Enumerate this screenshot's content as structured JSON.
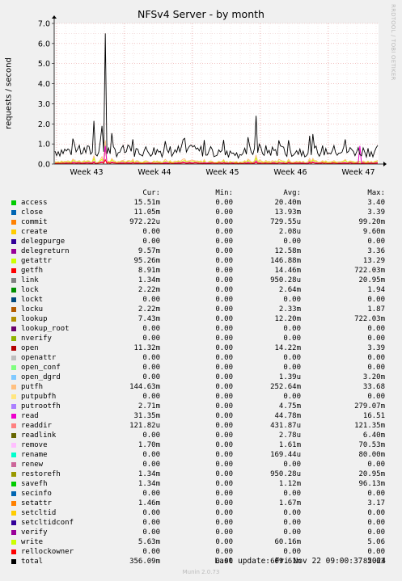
{
  "chart_data": {
    "type": "line",
    "title": "NFSv4 Server - by month",
    "ylabel": "requests / second",
    "watermark": "RRDTOOL / TOBI OETIKER",
    "ylim": [
      0,
      7
    ],
    "yticks": [
      "0.0",
      "1.0",
      "2.0",
      "3.0",
      "4.0",
      "5.0",
      "6.0",
      "7.0"
    ],
    "xticks": [
      "Week 43",
      "Week 44",
      "Week 45",
      "Week 46",
      "Week 47"
    ],
    "total_series_peaks": [
      {
        "label": "Week 43",
        "value": 6.5
      },
      {
        "label": "Week 46",
        "value": 2.4
      }
    ],
    "grid": true
  },
  "legend": {
    "headers": {
      "cur": "Cur:",
      "min": "Min:",
      "avg": "Avg:",
      "max": "Max:"
    },
    "rows": [
      {
        "name": "access",
        "color": "#00cc00",
        "cur": "15.51m",
        "min": "0.00",
        "avg": "20.40m",
        "max": "3.40"
      },
      {
        "name": "close",
        "color": "#0066b3",
        "cur": "11.05m",
        "min": "0.00",
        "avg": "13.93m",
        "max": "3.39"
      },
      {
        "name": "commit",
        "color": "#ff8000",
        "cur": "972.22u",
        "min": "0.00",
        "avg": "729.55u",
        "max": "99.20m"
      },
      {
        "name": "create",
        "color": "#ffcc00",
        "cur": "0.00",
        "min": "0.00",
        "avg": "2.08u",
        "max": "9.60m"
      },
      {
        "name": "delegpurge",
        "color": "#330099",
        "cur": "0.00",
        "min": "0.00",
        "avg": "0.00",
        "max": "0.00"
      },
      {
        "name": "delegreturn",
        "color": "#990099",
        "cur": "9.57m",
        "min": "0.00",
        "avg": "12.58m",
        "max": "3.36"
      },
      {
        "name": "getattr",
        "color": "#ccff00",
        "cur": "95.26m",
        "min": "0.00",
        "avg": "146.88m",
        "max": "13.29"
      },
      {
        "name": "getfh",
        "color": "#ff0000",
        "cur": "8.91m",
        "min": "0.00",
        "avg": "14.46m",
        "max": "722.03m"
      },
      {
        "name": "link",
        "color": "#808080",
        "cur": "1.34m",
        "min": "0.00",
        "avg": "950.28u",
        "max": "20.95m"
      },
      {
        "name": "lock",
        "color": "#008f00",
        "cur": "2.22m",
        "min": "0.00",
        "avg": "2.64m",
        "max": "1.94"
      },
      {
        "name": "lockt",
        "color": "#00487d",
        "cur": "0.00",
        "min": "0.00",
        "avg": "0.00",
        "max": "0.00"
      },
      {
        "name": "locku",
        "color": "#b35a00",
        "cur": "2.22m",
        "min": "0.00",
        "avg": "2.33m",
        "max": "1.87"
      },
      {
        "name": "lookup",
        "color": "#b38f00",
        "cur": "7.43m",
        "min": "0.00",
        "avg": "12.20m",
        "max": "722.03m"
      },
      {
        "name": "lookup_root",
        "color": "#6b006b",
        "cur": "0.00",
        "min": "0.00",
        "avg": "0.00",
        "max": "0.00"
      },
      {
        "name": "nverify",
        "color": "#8fb300",
        "cur": "0.00",
        "min": "0.00",
        "avg": "0.00",
        "max": "0.00"
      },
      {
        "name": "open",
        "color": "#b30000",
        "cur": "11.32m",
        "min": "0.00",
        "avg": "14.22m",
        "max": "3.39"
      },
      {
        "name": "openattr",
        "color": "#bebebe",
        "cur": "0.00",
        "min": "0.00",
        "avg": "0.00",
        "max": "0.00"
      },
      {
        "name": "open_conf",
        "color": "#80ff80",
        "cur": "0.00",
        "min": "0.00",
        "avg": "0.00",
        "max": "0.00"
      },
      {
        "name": "open_dgrd",
        "color": "#80c9ff",
        "cur": "0.00",
        "min": "0.00",
        "avg": "1.39u",
        "max": "3.20m"
      },
      {
        "name": "putfh",
        "color": "#ffc080",
        "cur": "144.63m",
        "min": "0.00",
        "avg": "252.64m",
        "max": "33.68"
      },
      {
        "name": "putpubfh",
        "color": "#ffe680",
        "cur": "0.00",
        "min": "0.00",
        "avg": "0.00",
        "max": "0.00"
      },
      {
        "name": "putrootfh",
        "color": "#aa80ff",
        "cur": "2.71m",
        "min": "0.00",
        "avg": "4.75m",
        "max": "279.07m"
      },
      {
        "name": "read",
        "color": "#ee00cc",
        "cur": "31.35m",
        "min": "0.00",
        "avg": "44.78m",
        "max": "16.51"
      },
      {
        "name": "readdir",
        "color": "#ff8080",
        "cur": "121.82u",
        "min": "0.00",
        "avg": "431.87u",
        "max": "121.35m"
      },
      {
        "name": "readlink",
        "color": "#666600",
        "cur": "0.00",
        "min": "0.00",
        "avg": "2.78u",
        "max": "6.40m"
      },
      {
        "name": "remove",
        "color": "#ffbfff",
        "cur": "1.70m",
        "min": "0.00",
        "avg": "1.61m",
        "max": "70.53m"
      },
      {
        "name": "rename",
        "color": "#00ffcc",
        "cur": "0.00",
        "min": "0.00",
        "avg": "169.44u",
        "max": "80.00m"
      },
      {
        "name": "renew",
        "color": "#cc6699",
        "cur": "0.00",
        "min": "0.00",
        "avg": "0.00",
        "max": "0.00"
      },
      {
        "name": "restorefh",
        "color": "#999900",
        "cur": "1.34m",
        "min": "0.00",
        "avg": "950.28u",
        "max": "20.95m"
      },
      {
        "name": "savefh",
        "color": "#00cc00",
        "cur": "1.34m",
        "min": "0.00",
        "avg": "1.12m",
        "max": "96.13m"
      },
      {
        "name": "secinfo",
        "color": "#0066b3",
        "cur": "0.00",
        "min": "0.00",
        "avg": "0.00",
        "max": "0.00"
      },
      {
        "name": "setattr",
        "color": "#ff8000",
        "cur": "1.46m",
        "min": "0.00",
        "avg": "1.67m",
        "max": "3.17"
      },
      {
        "name": "setcltid",
        "color": "#ffcc00",
        "cur": "0.00",
        "min": "0.00",
        "avg": "0.00",
        "max": "0.00"
      },
      {
        "name": "setcltidconf",
        "color": "#330099",
        "cur": "0.00",
        "min": "0.00",
        "avg": "0.00",
        "max": "0.00"
      },
      {
        "name": "verify",
        "color": "#990099",
        "cur": "0.00",
        "min": "0.00",
        "avg": "0.00",
        "max": "0.00"
      },
      {
        "name": "write",
        "color": "#ccff00",
        "cur": "5.63m",
        "min": "0.00",
        "avg": "60.16m",
        "max": "5.06"
      },
      {
        "name": "rellockowner",
        "color": "#ff0000",
        "cur": "0.00",
        "min": "0.00",
        "avg": "0.00",
        "max": "0.00"
      },
      {
        "name": "total",
        "color": "#000000",
        "cur": "356.09m",
        "min": "0.00",
        "avg": "609.61m",
        "max": "85.63"
      }
    ]
  },
  "footer": {
    "last_update": "Last update: Fri Nov 22 09:00:37 2024",
    "munin": "Munin 2.0.73"
  }
}
